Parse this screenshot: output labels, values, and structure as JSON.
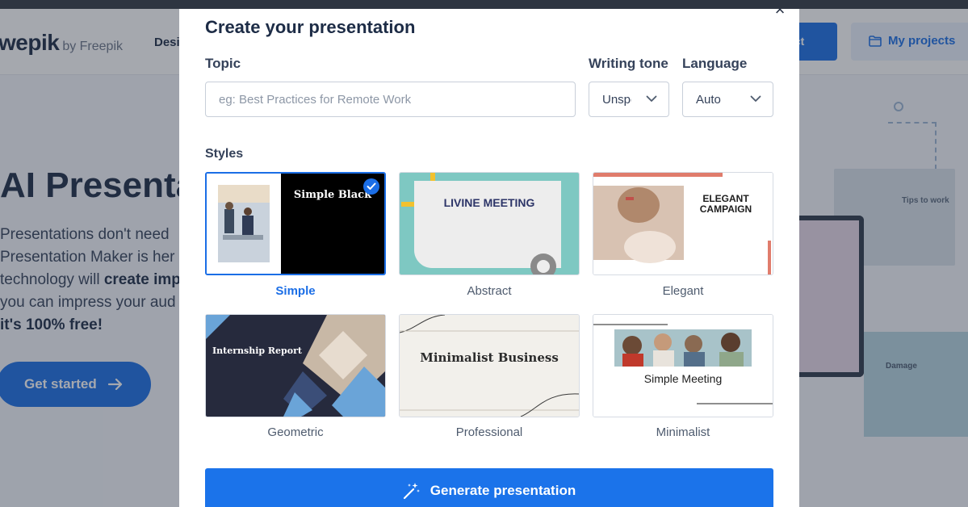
{
  "background": {
    "logo_main": "wepik",
    "logo_sub": "by Freepik",
    "nav_design": "Desi",
    "create_project": "ect",
    "my_projects": "My projects",
    "hero_title": "AI Presentation",
    "hero_lines": [
      "Presentations don't need",
      "Presentation Maker is her",
      "technology will ",
      "you can impress your aud",
      "it's 100% free!"
    ],
    "hero_bold": "create imp",
    "get_started": "Get started",
    "deco_label_1": "Tips to work",
    "deco_label_2": "Damage"
  },
  "modal": {
    "title": "Create your presentation",
    "close": "×",
    "topic_label": "Topic",
    "topic_placeholder": "eg: Best Practices for Remote Work",
    "topic_value": "",
    "tone_label": "Writing tone",
    "tone_value": "Unspecified",
    "language_label": "Language",
    "language_value": "Auto",
    "styles_label": "Styles",
    "styles": [
      {
        "name": "Simple",
        "thumb_text": "Simple Black",
        "selected": true
      },
      {
        "name": "Abstract",
        "thumb_text": "LIVINE MEETING",
        "selected": false
      },
      {
        "name": "Elegant",
        "thumb_text": "ELEGANT CAMPAIGN",
        "selected": false
      },
      {
        "name": "Geometric",
        "thumb_text": "Internship Report",
        "selected": false
      },
      {
        "name": "Professional",
        "thumb_text": "Minimalist Business",
        "selected": false
      },
      {
        "name": "Minimalist",
        "thumb_text": "Simple Meeting",
        "selected": false
      }
    ],
    "generate_label": "Generate presentation"
  },
  "colors": {
    "accent": "#1b6ee6",
    "overlay": "#28303e",
    "abstract_teal": "#7ec8c2",
    "elegant_coral": "#e07c6c",
    "geometric_navy": "#262a3d",
    "geometric_blue": "#6aa4d8"
  }
}
